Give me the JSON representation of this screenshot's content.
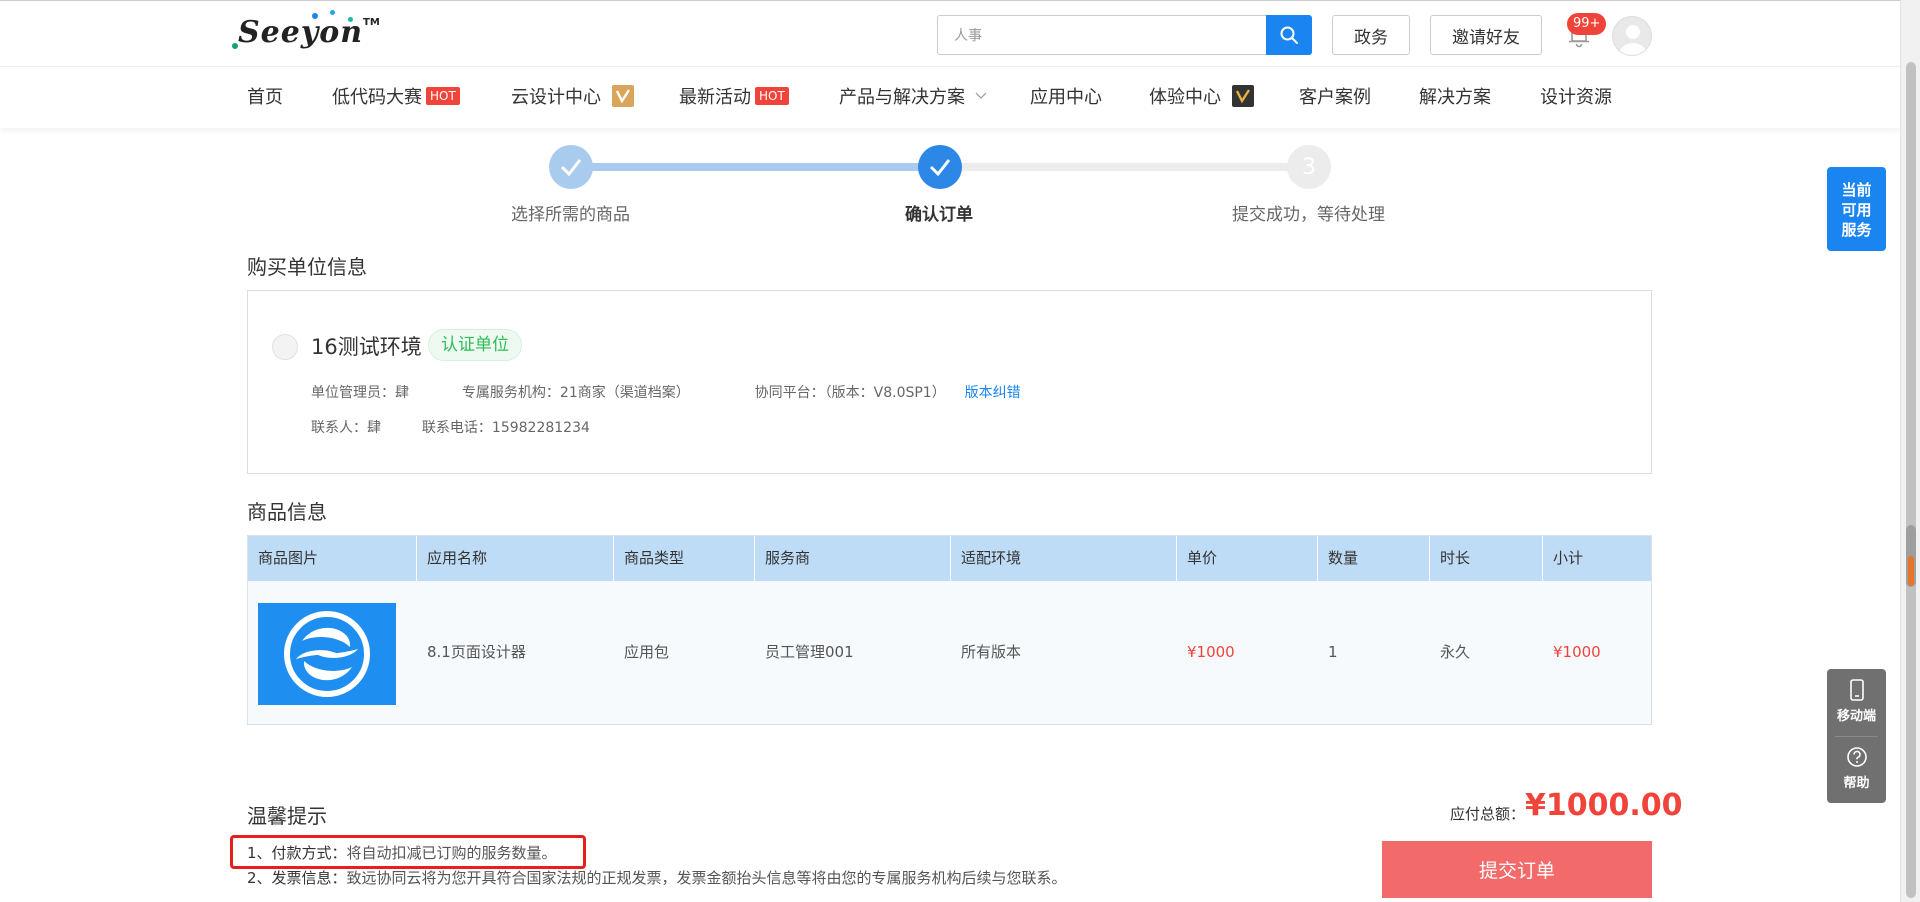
{
  "header": {
    "logo": "Seeyon",
    "logo_tm": "TM",
    "search_value": "人事",
    "btn_gov": "政务",
    "btn_invite": "邀请好友",
    "notif_badge": "99+"
  },
  "nav": {
    "items": [
      "首页",
      "低代码大赛",
      "云设计中心",
      "最新活动",
      "产品与解决方案",
      "应用中心",
      "体验中心",
      "客户案例",
      "解决方案",
      "设计资源"
    ],
    "hot": "HOT"
  },
  "steps": {
    "s1": "选择所需的商品",
    "s2": "确认订单",
    "s3": "提交成功，等待处理",
    "s3_num": "3"
  },
  "buyer": {
    "section_title": "购买单位信息",
    "name": "16测试环境",
    "cert": "认证单位",
    "admin": "单位管理员：肆",
    "service_org": "专属服务机构：21商家（渠道档案）",
    "platform": "协同平台：（版本：V8.0SP1）",
    "version_fix": "版本纠错",
    "contact": "联系人：肆",
    "phone": "联系电话：15982281234"
  },
  "goods": {
    "section_title": "商品信息",
    "headers": [
      "商品图片",
      "应用名称",
      "商品类型",
      "服务商",
      "适配环境",
      "单价",
      "数量",
      "时长",
      "小计"
    ],
    "row": {
      "name": "8.1页面设计器",
      "type": "应用包",
      "vendor": "员工管理001",
      "env": "所有版本",
      "unit_price": "¥1000",
      "qty": "1",
      "duration": "永久",
      "subtotal": "¥1000"
    }
  },
  "tips": {
    "title": "温馨提示",
    "t1_label": "1、付款方式：",
    "t1_text": "将自动扣减已订购的服务数量。",
    "t2_label": "2、发票信息：",
    "t2_text": "致远协同云将为您开具符合国家法规的正规发票，发票金额抬头信息等将由您的专属服务机构后续与您联系。"
  },
  "order": {
    "total_label": "应付总额：",
    "total_value": "¥1000.00",
    "submit": "提交订单"
  },
  "side": {
    "service": [
      "当前",
      "可用",
      "服务"
    ],
    "mobile": "移动端",
    "help": "帮助"
  },
  "colors": {
    "primary": "#1a84f0",
    "price_red": "#f0443a",
    "submit_bg": "#f36a6a",
    "table_header": "#bfdcf6",
    "cert_green": "#2fbd57"
  }
}
